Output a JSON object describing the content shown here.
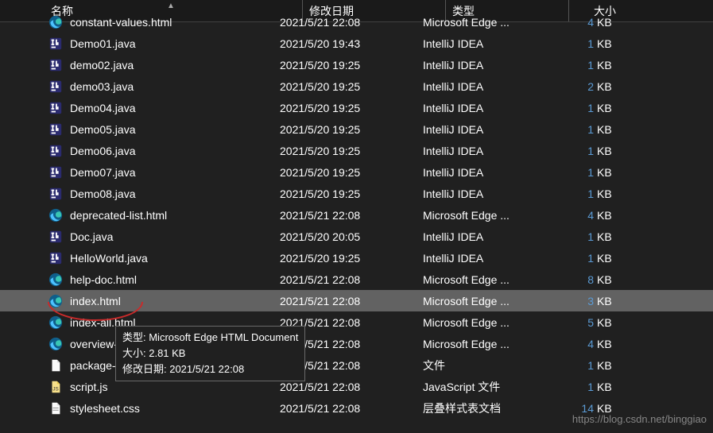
{
  "columns": {
    "name": "名称",
    "date": "修改日期",
    "type": "类型",
    "size": "大小"
  },
  "files": [
    {
      "name": "constant-values.html",
      "date": "2021/5/21 22:08",
      "type": "Microsoft Edge ...",
      "size": "4",
      "unit": "KB",
      "icon": "edge"
    },
    {
      "name": "Demo01.java",
      "date": "2021/5/20 19:43",
      "type": "IntelliJ IDEA",
      "size": "1",
      "unit": "KB",
      "icon": "intellij"
    },
    {
      "name": "demo02.java",
      "date": "2021/5/20 19:25",
      "type": "IntelliJ IDEA",
      "size": "1",
      "unit": "KB",
      "icon": "intellij"
    },
    {
      "name": "demo03.java",
      "date": "2021/5/20 19:25",
      "type": "IntelliJ IDEA",
      "size": "2",
      "unit": "KB",
      "icon": "intellij"
    },
    {
      "name": "Demo04.java",
      "date": "2021/5/20 19:25",
      "type": "IntelliJ IDEA",
      "size": "1",
      "unit": "KB",
      "icon": "intellij"
    },
    {
      "name": "Demo05.java",
      "date": "2021/5/20 19:25",
      "type": "IntelliJ IDEA",
      "size": "1",
      "unit": "KB",
      "icon": "intellij"
    },
    {
      "name": "Demo06.java",
      "date": "2021/5/20 19:25",
      "type": "IntelliJ IDEA",
      "size": "1",
      "unit": "KB",
      "icon": "intellij"
    },
    {
      "name": "Demo07.java",
      "date": "2021/5/20 19:25",
      "type": "IntelliJ IDEA",
      "size": "1",
      "unit": "KB",
      "icon": "intellij"
    },
    {
      "name": "Demo08.java",
      "date": "2021/5/20 19:25",
      "type": "IntelliJ IDEA",
      "size": "1",
      "unit": "KB",
      "icon": "intellij"
    },
    {
      "name": "deprecated-list.html",
      "date": "2021/5/21 22:08",
      "type": "Microsoft Edge ...",
      "size": "4",
      "unit": "KB",
      "icon": "edge"
    },
    {
      "name": "Doc.java",
      "date": "2021/5/20 20:05",
      "type": "IntelliJ IDEA",
      "size": "1",
      "unit": "KB",
      "icon": "intellij"
    },
    {
      "name": "HelloWorld.java",
      "date": "2021/5/20 19:25",
      "type": "IntelliJ IDEA",
      "size": "1",
      "unit": "KB",
      "icon": "intellij"
    },
    {
      "name": "help-doc.html",
      "date": "2021/5/21 22:08",
      "type": "Microsoft Edge ...",
      "size": "8",
      "unit": "KB",
      "icon": "edge"
    },
    {
      "name": "index.html",
      "date": "2021/5/21 22:08",
      "type": "Microsoft Edge ...",
      "size": "3",
      "unit": "KB",
      "icon": "edge",
      "selected": true
    },
    {
      "name": "index-all.html",
      "date": "2021/5/21 22:08",
      "type": "Microsoft Edge ...",
      "size": "5",
      "unit": "KB",
      "icon": "edge"
    },
    {
      "name": "overview-tree.html",
      "date": "2021/5/21 22:08",
      "type": "Microsoft Edge ...",
      "size": "4",
      "unit": "KB",
      "icon": "edge"
    },
    {
      "name": "package-list",
      "date": "2021/5/21 22:08",
      "type": "文件",
      "size": "1",
      "unit": "KB",
      "icon": "file"
    },
    {
      "name": "script.js",
      "date": "2021/5/21 22:08",
      "type": "JavaScript 文件",
      "size": "1",
      "unit": "KB",
      "icon": "js"
    },
    {
      "name": "stylesheet.css",
      "date": "2021/5/21 22:08",
      "type": "层叠样式表文档",
      "size": "14",
      "unit": "KB",
      "icon": "css"
    }
  ],
  "tooltip": {
    "line1": "类型: Microsoft Edge HTML Document",
    "line2": "大小: 2.81 KB",
    "line3": "修改日期: 2021/5/21 22:08"
  },
  "watermark": "https://blog.csdn.net/binggiao"
}
